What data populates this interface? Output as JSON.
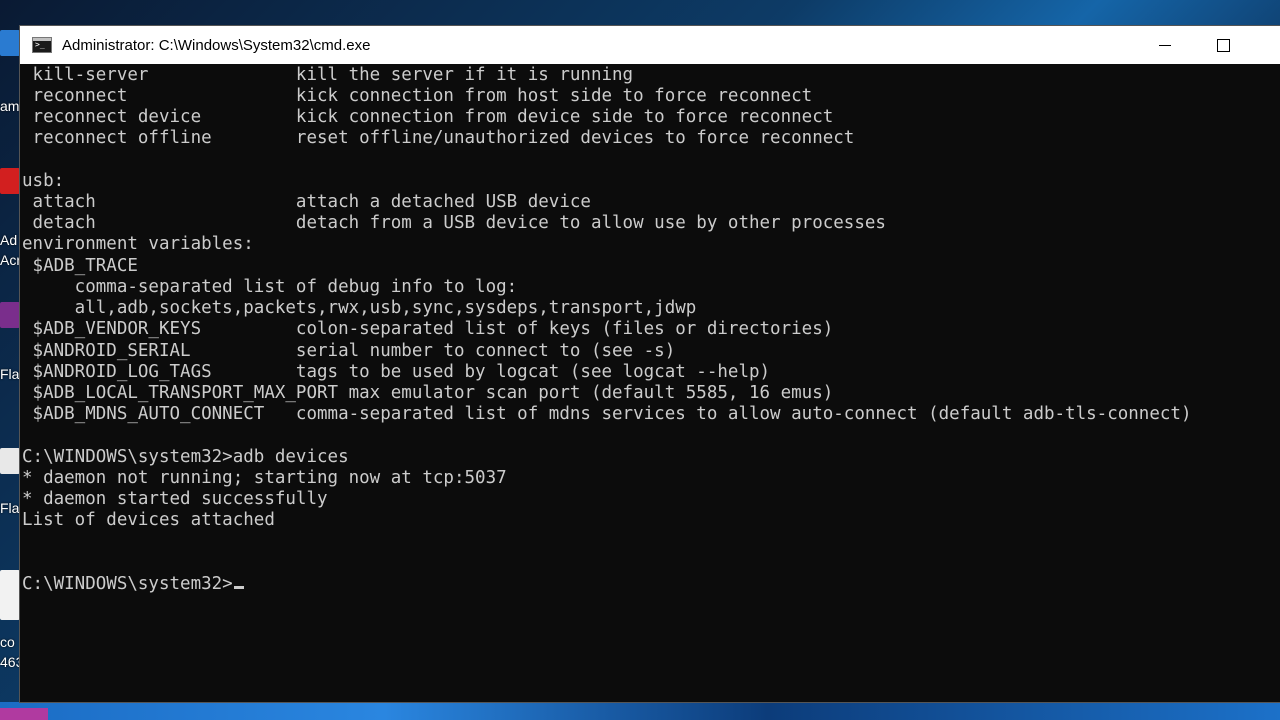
{
  "window": {
    "title": "Administrator: C:\\Windows\\System32\\cmd.exe",
    "icon": "cmd-icon",
    "controls": [
      "minimize",
      "maximize"
    ]
  },
  "desktop": {
    "labels": [
      "am",
      "Ad",
      "Acr",
      "Fla",
      "Fla",
      "co",
      "463"
    ]
  },
  "console": {
    "lines": [
      " kill-server              kill the server if it is running",
      " reconnect                kick connection from host side to force reconnect",
      " reconnect device         kick connection from device side to force reconnect",
      " reconnect offline        reset offline/unauthorized devices to force reconnect",
      "",
      "usb:",
      " attach                   attach a detached USB device",
      " detach                   detach from a USB device to allow use by other processes",
      "environment variables:",
      " $ADB_TRACE",
      "     comma-separated list of debug info to log:",
      "     all,adb,sockets,packets,rwx,usb,sync,sysdeps,transport,jdwp",
      " $ADB_VENDOR_KEYS         colon-separated list of keys (files or directories)",
      " $ANDROID_SERIAL          serial number to connect to (see -s)",
      " $ANDROID_LOG_TAGS        tags to be used by logcat (see logcat --help)",
      " $ADB_LOCAL_TRANSPORT_MAX_PORT max emulator scan port (default 5585, 16 emus)",
      " $ADB_MDNS_AUTO_CONNECT   comma-separated list of mdns services to allow auto-connect (default adb-tls-connect)",
      "",
      "C:\\WINDOWS\\system32>adb devices",
      "* daemon not running; starting now at tcp:5037",
      "* daemon started successfully",
      "List of devices attached",
      "",
      "",
      "C:\\WINDOWS\\system32>"
    ]
  }
}
